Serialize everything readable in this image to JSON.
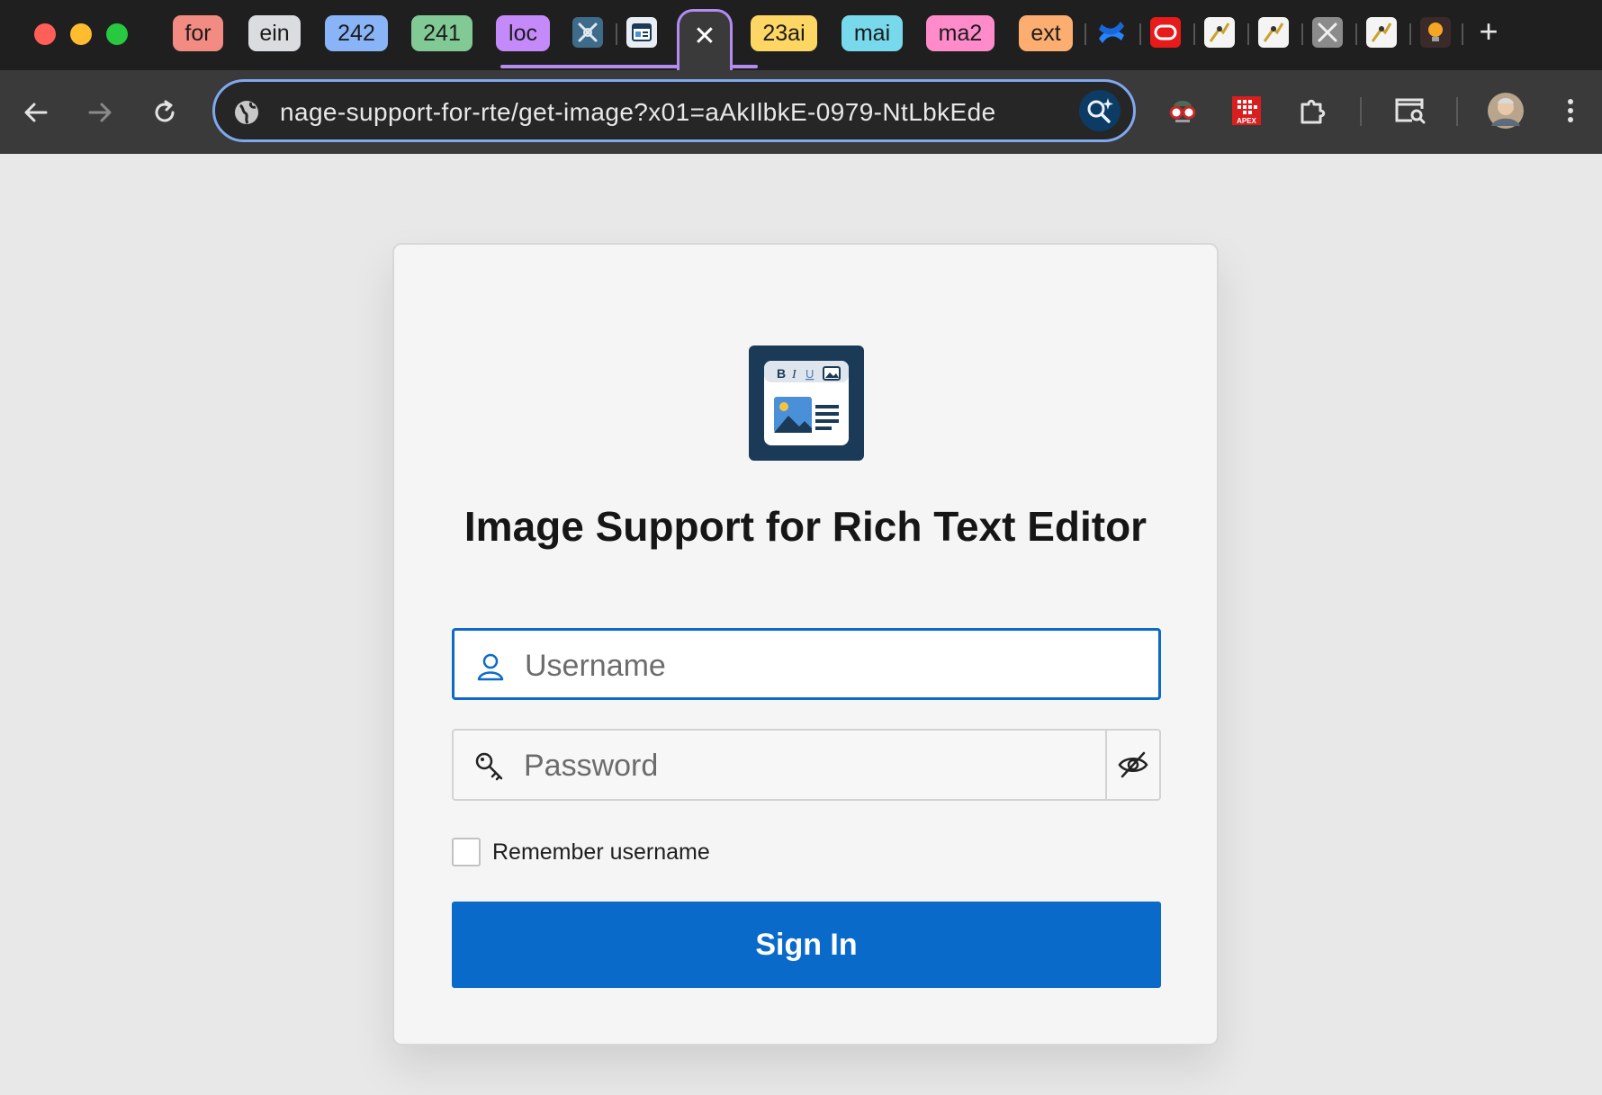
{
  "browser": {
    "tab_groups": [
      {
        "label": "for",
        "color": "#f28b82"
      },
      {
        "label": "ein",
        "color": "#dadce0"
      },
      {
        "label": "242",
        "color": "#8ab4f8"
      },
      {
        "label": "241",
        "color": "#81c995"
      },
      {
        "label": "loc",
        "color": "#c58af9"
      },
      {
        "label": "23ai",
        "color": "#fdd663"
      },
      {
        "label": "mai",
        "color": "#78d9ec"
      },
      {
        "label": "ma2",
        "color": "#ff8bcb"
      },
      {
        "label": "ext",
        "color": "#fcad70"
      }
    ],
    "new_tab_label": "+",
    "close_tab_label": "✕",
    "url": "nage-support-for-rte/get-image?x01=aAkIlbkE-0979-NtLbkEde",
    "extension_apex_label": "APEX"
  },
  "login": {
    "title": "Image Support for Rich Text Editor",
    "logo_toolbar": {
      "bold": "B",
      "italic": "I",
      "underline": "U"
    },
    "username_placeholder": "Username",
    "password_placeholder": "Password",
    "remember_label": "Remember username",
    "sign_in_label": "Sign In"
  },
  "colors": {
    "accent": "#0a6ac9",
    "logo_bg": "#1b3a57",
    "active_tab_outline": "#b48cf0"
  }
}
